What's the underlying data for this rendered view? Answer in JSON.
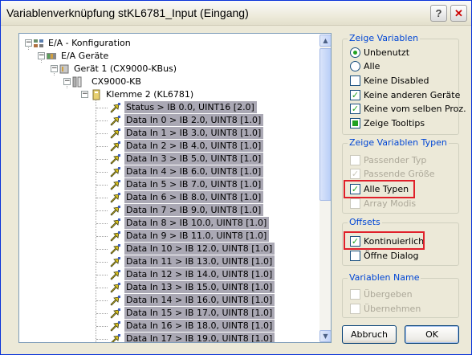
{
  "window": {
    "title": "Variablenverknüpfung stKL6781_Input (Eingang)",
    "help_label": "?",
    "close_label": "✕"
  },
  "tree": {
    "root": "E/A - Konfiguration",
    "geraete": "E/A Geräte",
    "geraet1": "Gerät 1 (CX9000-KBus)",
    "cx": "CX9000-KB",
    "klemme": "Klemme 2 (KL6781)",
    "toggle_minus": "−",
    "variables": [
      "Status   >  IB 0.0, UINT16 [2.0]",
      "Data In 0   >  IB 2.0, UINT8 [1.0]",
      "Data In 1   >  IB 3.0, UINT8 [1.0]",
      "Data In 2   >  IB 4.0, UINT8 [1.0]",
      "Data In 3   >  IB 5.0, UINT8 [1.0]",
      "Data In 4   >  IB 6.0, UINT8 [1.0]",
      "Data In 5   >  IB 7.0, UINT8 [1.0]",
      "Data In 6   >  IB 8.0, UINT8 [1.0]",
      "Data In 7   >  IB 9.0, UINT8 [1.0]",
      "Data In 8   >  IB 10.0, UINT8 [1.0]",
      "Data In 9   >  IB 11.0, UINT8 [1.0]",
      "Data In 10   >  IB 12.0, UINT8 [1.0]",
      "Data In 11   >  IB 13.0, UINT8 [1.0]",
      "Data In 12   >  IB 14.0, UINT8 [1.0]",
      "Data In 13   >  IB 15.0, UINT8 [1.0]",
      "Data In 14   >  IB 16.0, UINT8 [1.0]",
      "Data In 15   >  IB 17.0, UINT8 [1.0]",
      "Data In 16   >  IB 18.0, UINT8 [1.0]",
      "Data In 17   >  IB 19.0, UINT8 [1.0]"
    ]
  },
  "scrollbar": {
    "up": "▲",
    "down": "▼"
  },
  "zeige_variablen": {
    "title": "Zeige Variablen",
    "unbenutzt": "Unbenutzt",
    "alle": "Alle",
    "keine_disabled": "Keine Disabled",
    "keine_anderen": "Keine anderen Geräte",
    "keine_selben": "Keine vom selben Proz.",
    "tooltips": "Zeige Tooltips"
  },
  "zeige_typen": {
    "title": "Zeige Variablen Typen",
    "passender_typ": "Passender Typ",
    "passende_groesse": "Passende Größe",
    "alle_typen": "Alle Typen",
    "array_modis": "Array Modis"
  },
  "offsets": {
    "title": "Offsets",
    "kontinuierlich": "Kontinuierlich",
    "oeffne_dialog": "Öffne Dialog"
  },
  "variablen_name": {
    "title": "Variablen Name",
    "uebergeben": "Übergeben",
    "uebernehmen": "Übernehmen"
  },
  "buttons": {
    "abbruch": "Abbruch",
    "ok": "OK"
  },
  "glyphs": {
    "check": "✓"
  },
  "colors": {
    "highlight_border": "#e0202a",
    "selected_bg": "#aaa8b4",
    "group_title": "#0046d5",
    "check": "#21a121"
  }
}
